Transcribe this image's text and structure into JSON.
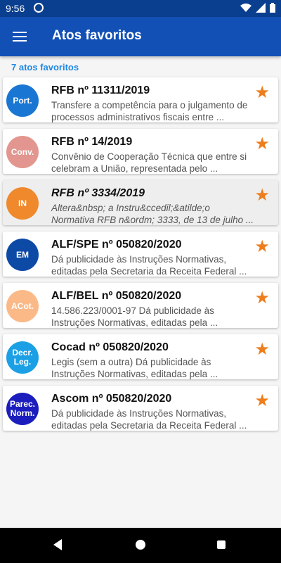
{
  "status": {
    "time": "9:56"
  },
  "app_bar": {
    "title": "Atos favoritos"
  },
  "count_label": "7 atos favoritos",
  "items": [
    {
      "badge": "Port.",
      "badge_color": "#1976d2",
      "title": "RFB nº 11311/2019",
      "desc": "Transfere a competência para o julgamento de processos administrativos fiscais entre ...",
      "selected": false
    },
    {
      "badge": "Conv.",
      "badge_color": "#e2968f",
      "title": "RFB nº 14/2019",
      "desc": "Convênio de Cooperação Técnica que entre si celebram a União, representada pelo ...",
      "selected": false
    },
    {
      "badge": "IN",
      "badge_color": "#f0882c",
      "title": "RFB nº 3334/2019",
      "desc": "Altera&nbsp; a Instru&ccedil;&atilde;o Normativa RFB n&ordm; 3333, de 13 de julho ...",
      "selected": true
    },
    {
      "badge": "EM",
      "badge_color": "#0d4aa6",
      "title": "ALF/SPE nº 050820/2020",
      "desc": "Dá publicidade às Instruções Normativas, editadas pela Secretaria da Receita Federal ...",
      "selected": false
    },
    {
      "badge": "ACot.",
      "badge_color": "#fbb988",
      "title": "ALF/BEL nº 050820/2020",
      "desc": "14.586.223/0001-97 Dá publicidade às Instruções Normativas, editadas pela ...",
      "selected": false
    },
    {
      "badge": "Decr.\nLeg.",
      "badge_color": "#1ba0e6",
      "title": "Cocad nº 050820/2020",
      "desc": "Legis (sem a outra) Dá publicidade às Instruções Normativas, editadas pela ...",
      "selected": false
    },
    {
      "badge": "Parec.\nNorm.",
      "badge_color": "#1b1ebd",
      "title": "Ascom nº 050820/2020",
      "desc": "Dá publicidade às Instruções Normativas, editadas pela Secretaria da Receita Federal ...",
      "selected": false
    }
  ],
  "accent_star": "#ee7d1c",
  "icons": {
    "menu": "menu-icon",
    "star": "star-icon",
    "wifi": "wifi-icon",
    "battery": "battery-icon"
  }
}
